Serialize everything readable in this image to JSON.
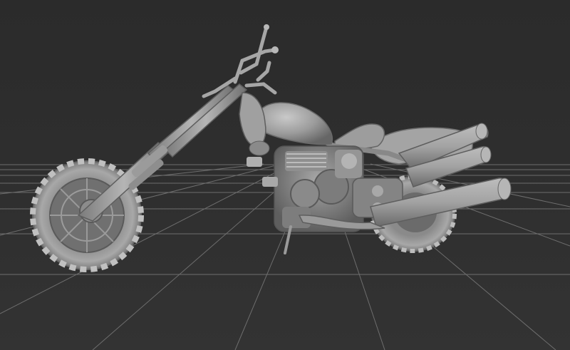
{
  "viewport": {
    "background": "#303030",
    "grid_color": "#6e6e6e",
    "model_color": "#9a9a9a",
    "model_shadow": "#5f5f5f",
    "model_highlight": "#c8c8c8",
    "model": "motorcycle-chopper",
    "shading": "gray-clay"
  }
}
